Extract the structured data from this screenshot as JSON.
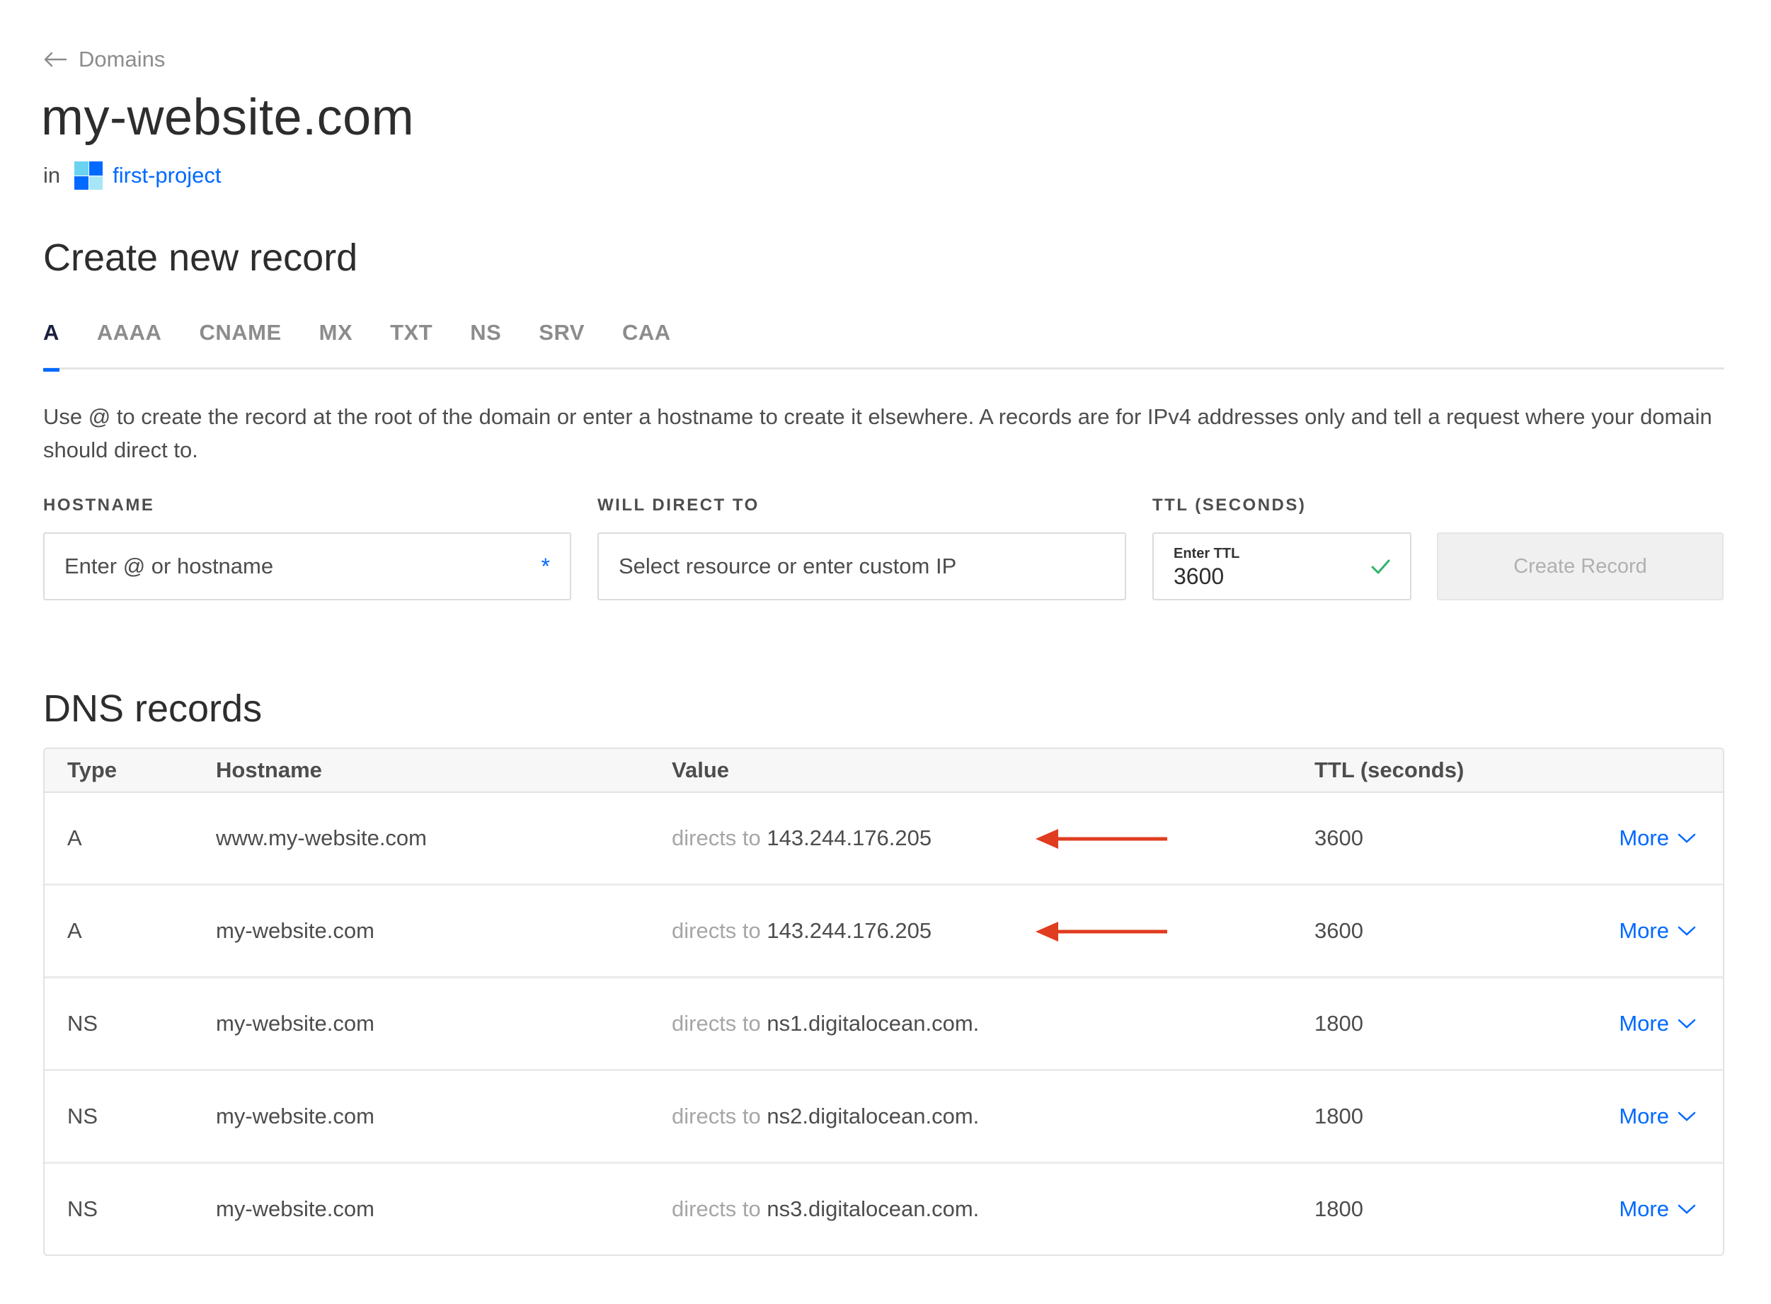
{
  "breadcrumb": {
    "label": "Domains"
  },
  "domain": {
    "title": "my-website.com",
    "in_label": "in",
    "project_name": "first-project"
  },
  "create": {
    "heading": "Create new record",
    "tabs": [
      "A",
      "AAAA",
      "CNAME",
      "MX",
      "TXT",
      "NS",
      "SRV",
      "CAA"
    ],
    "active_tab": "A",
    "help": "Use @ to create the record at the root of the domain or enter a hostname to create it elsewhere. A records are for IPv4 addresses only and tell a request where your domain should direct to.",
    "hostname_label": "HOSTNAME",
    "hostname_placeholder": "Enter @ or hostname",
    "hostname_required": "*",
    "direct_label": "WILL DIRECT TO",
    "direct_placeholder": "Select resource or enter custom IP",
    "ttl_label": "TTL (SECONDS)",
    "ttl_inner_label": "Enter TTL",
    "ttl_value": "3600",
    "button": "Create Record"
  },
  "dns": {
    "heading": "DNS records",
    "columns": {
      "type": "Type",
      "hostname": "Hostname",
      "value": "Value",
      "ttl": "TTL (seconds)"
    },
    "directs_label": "directs to",
    "more_label": "More",
    "rows": [
      {
        "type": "A",
        "hostname": "www.my-website.com",
        "value": "143.244.176.205",
        "ttl": "3600",
        "annotated": true
      },
      {
        "type": "A",
        "hostname": "my-website.com",
        "value": "143.244.176.205",
        "ttl": "3600",
        "annotated": true
      },
      {
        "type": "NS",
        "hostname": "my-website.com",
        "value": "ns1.digitalocean.com.",
        "ttl": "1800",
        "annotated": false
      },
      {
        "type": "NS",
        "hostname": "my-website.com",
        "value": "ns2.digitalocean.com.",
        "ttl": "1800",
        "annotated": false
      },
      {
        "type": "NS",
        "hostname": "my-website.com",
        "value": "ns3.digitalocean.com.",
        "ttl": "1800",
        "annotated": false
      }
    ]
  },
  "colors": {
    "accent": "#0069ff",
    "annotation_arrow": "#e03c1f",
    "success_check": "#2fb36b"
  },
  "icons": {
    "back": "arrow-left-icon",
    "check": "check-icon",
    "chevron": "chevron-down-icon",
    "annotation": "red-arrow-icon"
  }
}
